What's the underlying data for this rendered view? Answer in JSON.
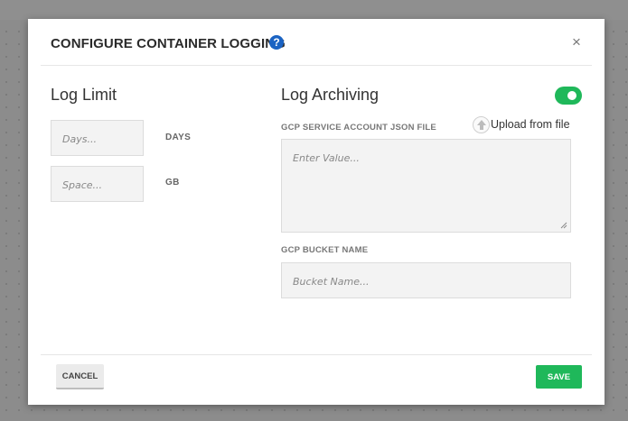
{
  "dialog": {
    "title": "CONFIGURE CONTAINER LOGGING",
    "help_glyph": "?",
    "close_glyph": "×"
  },
  "log_limit": {
    "title": "Log Limit",
    "days": {
      "placeholder": "Days...",
      "value": "",
      "unit": "DAYS"
    },
    "space": {
      "placeholder": "Space...",
      "value": "",
      "unit": "GB"
    }
  },
  "log_archiving": {
    "title": "Log Archiving",
    "enabled": true,
    "toggle_color": "#1fb85a",
    "json_label": "GCP SERVICE ACCOUNT JSON FILE",
    "upload_label": "Upload from file",
    "json_placeholder": "Enter Value...",
    "bucket_label": "GCP BUCKET NAME",
    "bucket_placeholder": "Bucket Name..."
  },
  "footer": {
    "cancel_label": "CANCEL",
    "save_label": "SAVE",
    "save_color": "#1fb85a"
  },
  "icons": [
    "help-icon",
    "close-icon",
    "upload-icon",
    "toggle-switch"
  ]
}
